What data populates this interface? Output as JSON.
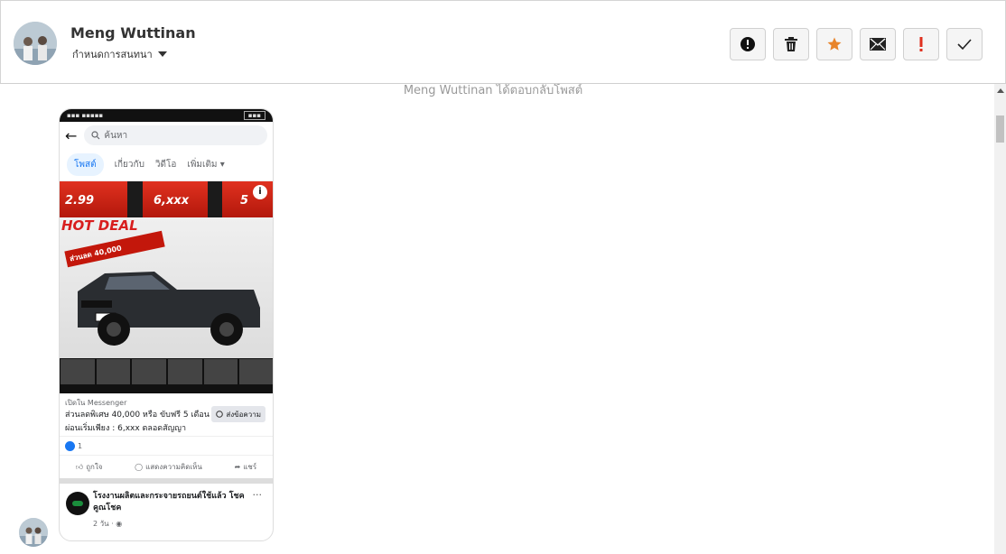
{
  "header": {
    "contact_name": "Meng Wuttinan",
    "assign_label": "กำหนดการสนทนา",
    "actions": [
      {
        "name": "report-button",
        "icon": "alert-circle-icon"
      },
      {
        "name": "delete-button",
        "icon": "trash-icon"
      },
      {
        "name": "star-button",
        "icon": "star-icon"
      },
      {
        "name": "mail-button",
        "icon": "envelope-icon"
      },
      {
        "name": "important-button",
        "icon": "exclamation-icon"
      },
      {
        "name": "done-button",
        "icon": "check-icon"
      }
    ],
    "star_color": "#e8842a",
    "important_color": "#e0301e"
  },
  "conversation": {
    "event_text": "Meng Wuttinan ได้ตอบกลับโพสต์"
  },
  "shared_post": {
    "search_placeholder": "ค้นหา",
    "tabs": [
      "โพสต์",
      "เกี่ยวกับ",
      "วิดีโอ",
      "เพิ่มเติม"
    ],
    "ad_text": {
      "rate": "2.99",
      "installment": "6,xxx",
      "months": "5",
      "hot_deal": "HOT DEAL",
      "discount": "ส่วนลด 40,000"
    },
    "cta_source": "เปิดใน Messenger",
    "cta_headline": "ส่วนลดพิเศษ 40,000 หรือ ขับฟรี 5 เดือน ผ่อนเริ่มเพียง : 6,xxx ตลอดสัญญา",
    "cta_button": "ส่งข้อความ",
    "reaction_count": "1",
    "like_label": "ถูกใจ",
    "comment_label": "แสดงความคิดเห็น",
    "share_label": "แชร์",
    "page_name": "โรงงานผลิตและกระจายรถยนต์ใช้แล้ว โชคคูณโชค",
    "post_time": "2 วัน ·"
  }
}
